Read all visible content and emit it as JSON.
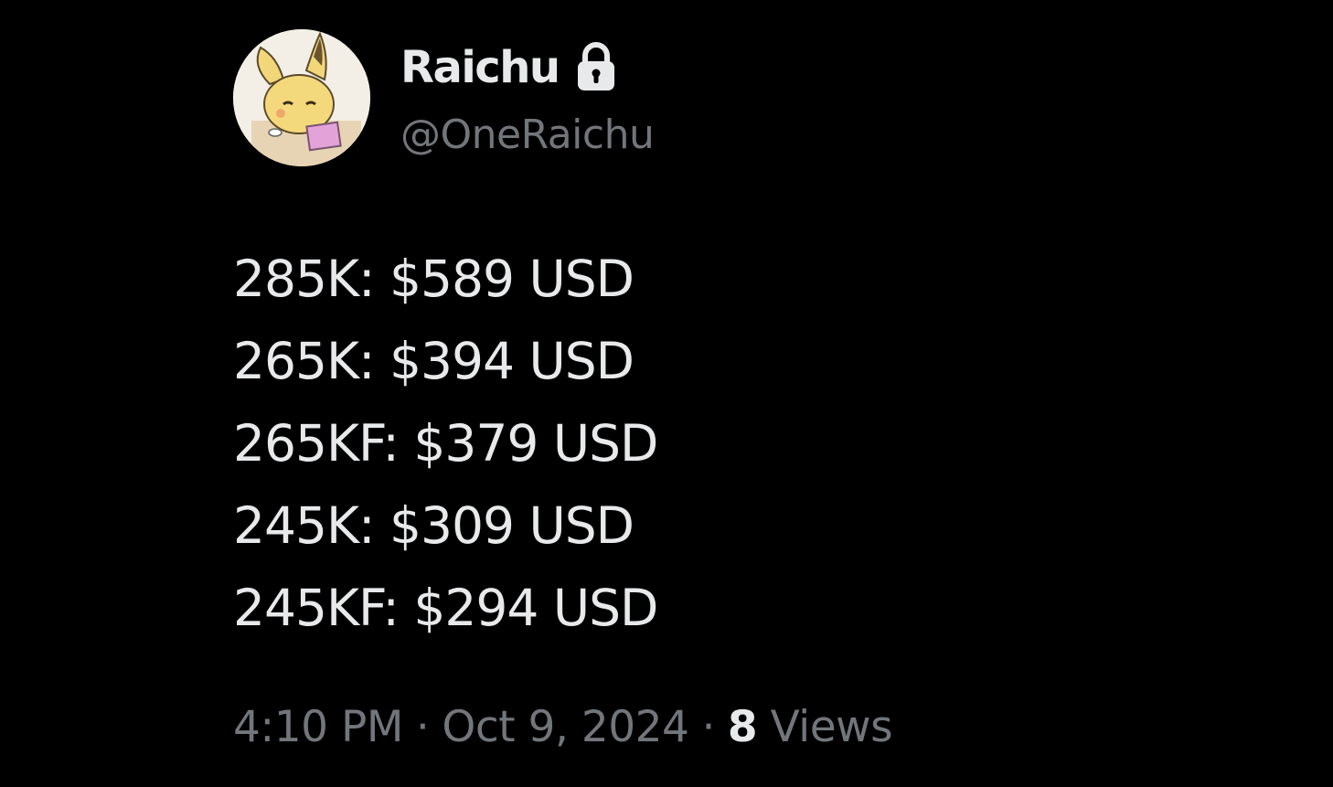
{
  "author": {
    "display_name": "Raichu",
    "handle": "@OneRaichu",
    "avatar_icon": "raichu-avatar",
    "protected_icon": "lock-icon"
  },
  "tweet": {
    "lines": [
      "285K: $589 USD",
      "265K: $394 USD",
      "265KF: $379 USD",
      "245K: $309 USD",
      "245KF: $294 USD"
    ]
  },
  "meta": {
    "time": "4:10 PM",
    "separator": "·",
    "date": "Oct 9, 2024",
    "views_count": "8",
    "views_label": "Views"
  },
  "colors": {
    "background": "#000000",
    "primary_text": "#e7e9ea",
    "secondary_text": "#71767b"
  }
}
